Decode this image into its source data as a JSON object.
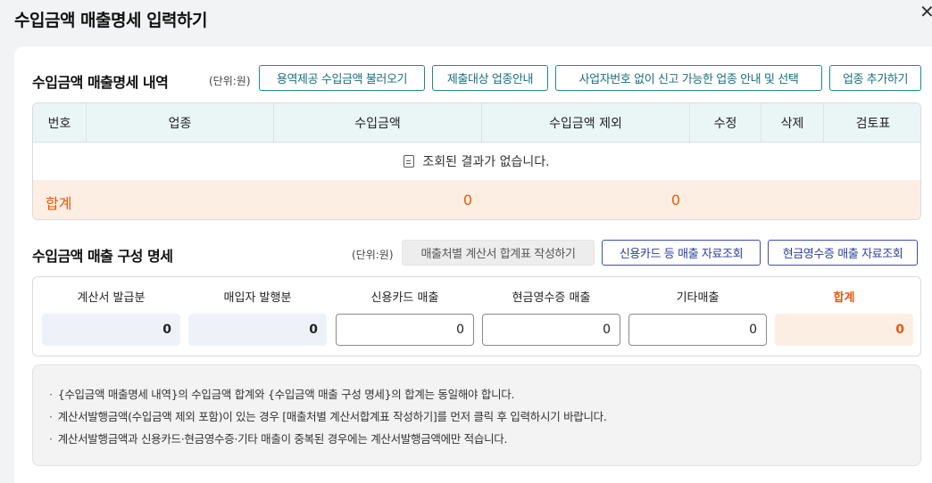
{
  "modal": {
    "title": "수입금액 매출명세 입력하기"
  },
  "section1": {
    "title": "수입금액 매출명세 내역",
    "unit": "(단위:원)",
    "buttons": [
      "용역제공 수입금액 불러오기",
      "제출대상 업종안내",
      "사업자번호 없이 신고 가능한 업종 안내 및 선택",
      "업종 추가하기"
    ],
    "columns": [
      "번호",
      "업종",
      "수입금액",
      "수입금액 제외",
      "수정",
      "삭제",
      "검토표"
    ],
    "empty_message": "조회된 결과가 없습니다.",
    "total": {
      "label": "합계",
      "revenue": "0",
      "excluded": "0"
    }
  },
  "section2": {
    "title": "수입금액 매출 구성 명세",
    "unit": "(단위:원)",
    "buttons": [
      "매출처별 계산서 합계표 작성하기",
      "신용카드 등 매출 자료조회",
      "현금영수증 매출 자료조회"
    ],
    "items": [
      {
        "label": "계산서 발급분",
        "value": "0"
      },
      {
        "label": "매입자 발행분",
        "value": "0"
      },
      {
        "label": "신용카드 매출",
        "value": "0"
      },
      {
        "label": "현금영수증 매출",
        "value": "0"
      },
      {
        "label": "기타매출",
        "value": "0"
      },
      {
        "label": "합계",
        "value": "0"
      }
    ]
  },
  "notes": [
    "{수입금액 매출명세 내역}의 수입금액 합계와 {수입금액 매출 구성 명세}의 합계는 동일해야 합니다.",
    "계산서발행금액(수입금액 제외 포함)이 있는 경우 [매출처별 계산서합계표 작성하기]를 먼저 클릭 후 입력하시기 바랍니다.",
    "계산서발행금액과 신용카드·현금영수증·기타 매출이 중복된 경우에는 계산서발행금액에만 적습니다."
  ],
  "colors": {
    "accent": "#17707a",
    "total": "#e8590c",
    "blue_button": "#2b3f9e"
  }
}
